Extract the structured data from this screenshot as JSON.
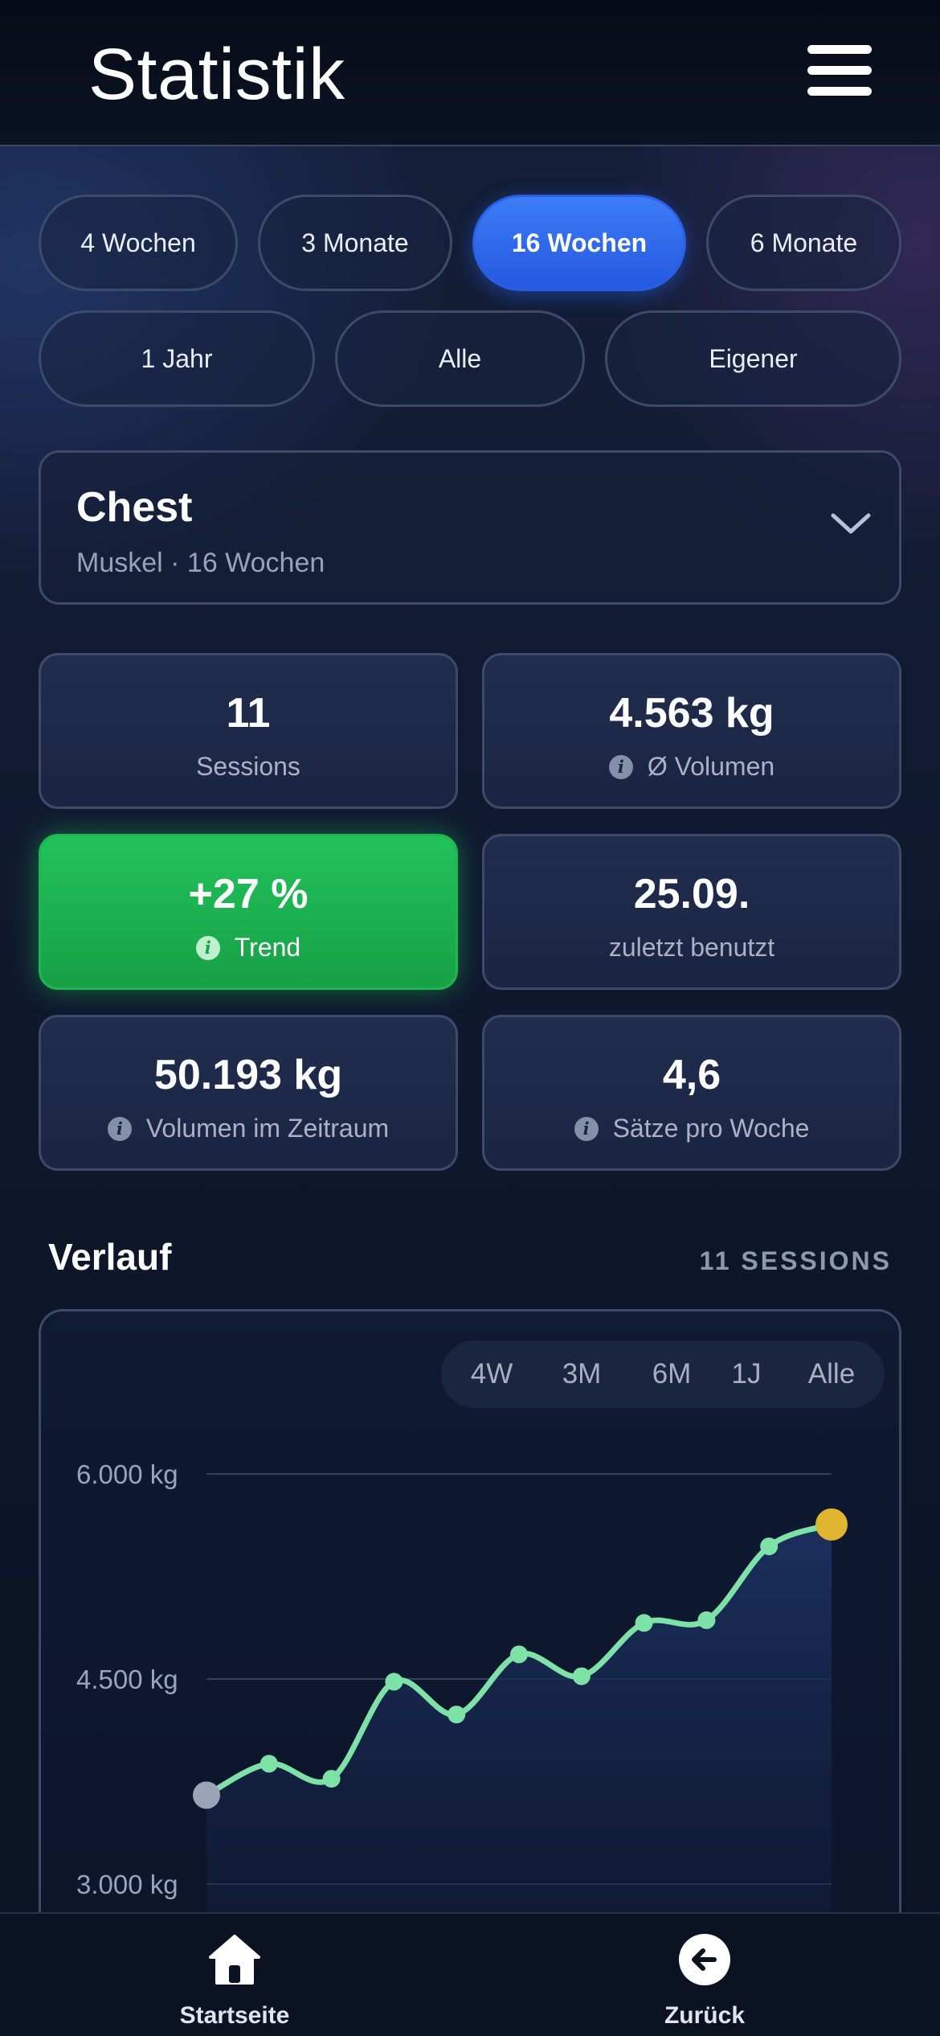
{
  "header": {
    "title": "Statistik",
    "menu_icon": "hamburger-menu-icon"
  },
  "period_filters": [
    {
      "label": "4 Wochen",
      "active": false
    },
    {
      "label": "3 Monate",
      "active": false
    },
    {
      "label": "16 Wochen",
      "active": true
    },
    {
      "label": "6 Monate",
      "active": false
    },
    {
      "label": "1 Jahr",
      "active": false
    },
    {
      "label": "Alle",
      "active": false
    },
    {
      "label": "Eigener",
      "active": false
    }
  ],
  "selector": {
    "title": "Chest",
    "subtitle": "Muskel · 16 Wochen",
    "icon": "chevron-down-icon"
  },
  "stats": [
    {
      "value": "11",
      "label": "Sessions",
      "info": false,
      "highlight": false
    },
    {
      "value": "4.563 kg",
      "label": "Ø Volumen",
      "info": true,
      "highlight": false
    },
    {
      "value": "+27 %",
      "label": "Trend",
      "info": true,
      "highlight": true
    },
    {
      "value": "25.09.",
      "label": "zuletzt benutzt",
      "info": false,
      "highlight": false
    },
    {
      "value": "50.193 kg",
      "label": "Volumen im Zeitraum",
      "info": true,
      "highlight": false
    },
    {
      "value": "4,6",
      "label": "Sätze pro Woche",
      "info": true,
      "highlight": false
    }
  ],
  "section": {
    "title": "Verlauf",
    "meta": "11 SESSIONS"
  },
  "chart_tabs": [
    "4W",
    "3M",
    "6M",
    "1J",
    "Alle"
  ],
  "chart_data": {
    "type": "line",
    "title": "",
    "xlabel": "",
    "ylabel": "",
    "y_ticks": [
      "6.000 kg",
      "4.500 kg",
      "3.000 kg"
    ],
    "ylim": [
      3000,
      6000
    ],
    "grid": true,
    "series": [
      {
        "values": [
          3650,
          3880,
          3770,
          4480,
          4240,
          4680,
          4520,
          4910,
          4930,
          5470,
          5630
        ]
      }
    ],
    "colors": {
      "line": "#7ee2a8",
      "first_point": "#9aa3b8",
      "last_point": "#e0b530",
      "area_top": "#1c3160",
      "area_bottom": "#0f1a33"
    }
  },
  "bottom_nav": [
    {
      "label": "Startseite",
      "icon": "home-icon"
    },
    {
      "label": "Zurück",
      "icon": "arrow-left-circle-icon"
    }
  ]
}
